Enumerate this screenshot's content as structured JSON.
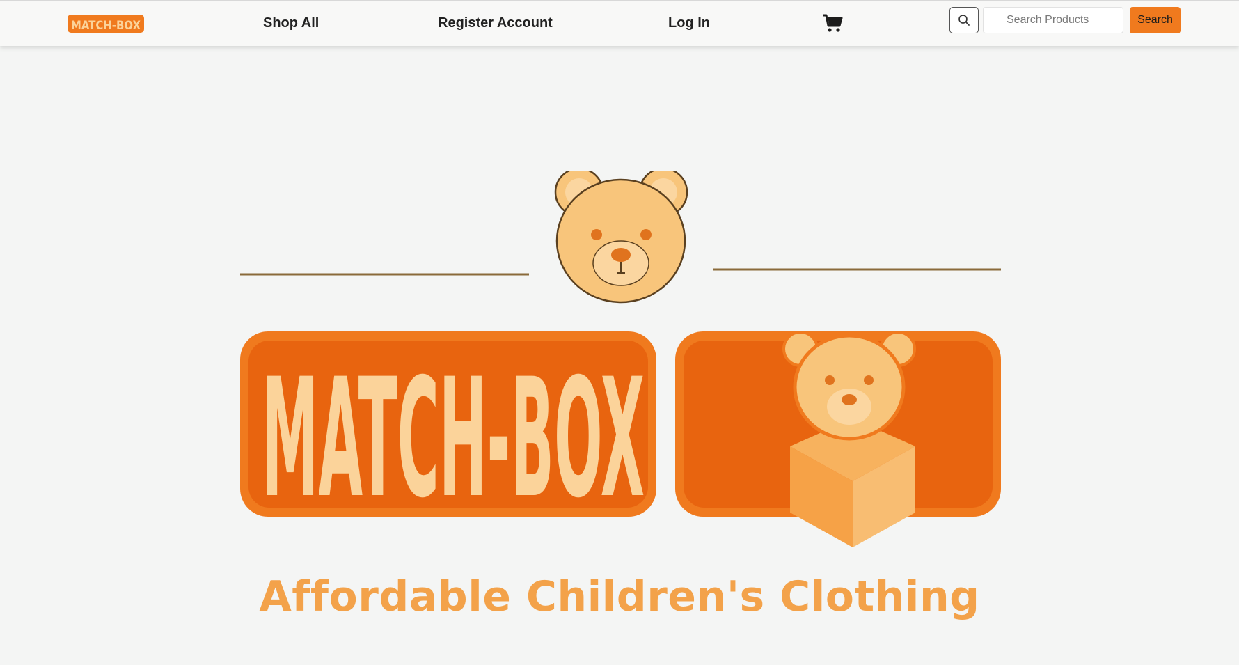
{
  "nav": {
    "brand_text": "MATCH-BOX",
    "links": [
      {
        "label": "Shop All"
      },
      {
        "label": "Register Account"
      },
      {
        "label": "Log In"
      }
    ],
    "cart_icon": "shopping-cart-icon"
  },
  "search": {
    "icon": "search-icon",
    "placeholder": "Search Products",
    "button_label": "Search"
  },
  "hero": {
    "logo_text": "MATCH-BOX",
    "tagline": "Affordable Children's Clothing"
  },
  "colors": {
    "accent": "#f07a1e",
    "logo_fill": "#fbd39a",
    "bear": "#f8c57b",
    "tagline": "#f3a24a",
    "background": "#f4f5f4"
  }
}
